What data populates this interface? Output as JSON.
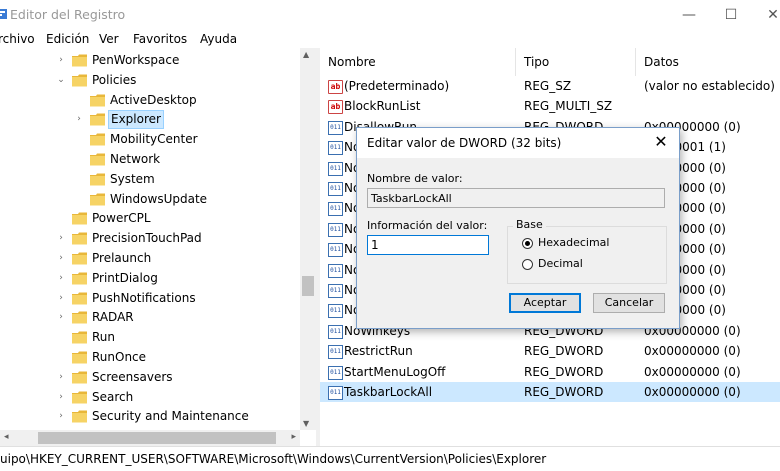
{
  "window": {
    "title": "Editor del Registro",
    "minimize": "—",
    "maximize": "☐",
    "close": "✕"
  },
  "menu": [
    "rchivo",
    "Edición",
    "Ver",
    "Favoritos",
    "Ayuda"
  ],
  "tree": [
    {
      "label": "PenWorkspace",
      "level": 1,
      "arrow": "›"
    },
    {
      "label": "Policies",
      "level": 1,
      "arrow": "⌄"
    },
    {
      "label": "ActiveDesktop",
      "level": 2,
      "arrow": ""
    },
    {
      "label": "Explorer",
      "level": 2,
      "arrow": "›",
      "selected": true
    },
    {
      "label": "MobilityCenter",
      "level": 2,
      "arrow": ""
    },
    {
      "label": "Network",
      "level": 2,
      "arrow": ""
    },
    {
      "label": "System",
      "level": 2,
      "arrow": ""
    },
    {
      "label": "WindowsUpdate",
      "level": 2,
      "arrow": ""
    },
    {
      "label": "PowerCPL",
      "level": 1,
      "arrow": ""
    },
    {
      "label": "PrecisionTouchPad",
      "level": 1,
      "arrow": "›"
    },
    {
      "label": "Prelaunch",
      "level": 1,
      "arrow": "›"
    },
    {
      "label": "PrintDialog",
      "level": 1,
      "arrow": "›"
    },
    {
      "label": "PushNotifications",
      "level": 1,
      "arrow": "›"
    },
    {
      "label": "RADAR",
      "level": 1,
      "arrow": "›"
    },
    {
      "label": "Run",
      "level": 1,
      "arrow": ""
    },
    {
      "label": "RunOnce",
      "level": 1,
      "arrow": ""
    },
    {
      "label": "Screensavers",
      "level": 1,
      "arrow": "›"
    },
    {
      "label": "Search",
      "level": 1,
      "arrow": "›"
    },
    {
      "label": "Security and Maintenance",
      "level": 1,
      "arrow": "›"
    }
  ],
  "list": {
    "columns": [
      "Nombre",
      "Tipo",
      "Datos"
    ],
    "rows": [
      {
        "name": "(Predeterminado)",
        "type": "REG_SZ",
        "data": "(valor no establecido)",
        "icon": "string-value-icon"
      },
      {
        "name": "BlockRunList",
        "type": "REG_MULTI_SZ",
        "data": "",
        "icon": "string-value-icon"
      },
      {
        "name": "DisallowRun",
        "type": "REG_DWORD",
        "data": "0x00000000 (0)",
        "icon": "dword-value-icon"
      },
      {
        "name": "No",
        "type": "",
        "data": "00000001 (1)",
        "icon": "dword-value-icon"
      },
      {
        "name": "No",
        "type": "",
        "data": "00000000 (0)",
        "icon": "dword-value-icon"
      },
      {
        "name": "No",
        "type": "",
        "data": "00000000 (0)",
        "icon": "dword-value-icon"
      },
      {
        "name": "No",
        "type": "",
        "data": "00000000 (0)",
        "icon": "dword-value-icon"
      },
      {
        "name": "No",
        "type": "",
        "data": "00000000 (0)",
        "icon": "dword-value-icon"
      },
      {
        "name": "No",
        "type": "",
        "data": "00000000 (0)",
        "icon": "dword-value-icon"
      },
      {
        "name": "No",
        "type": "",
        "data": "00000000 (0)",
        "icon": "dword-value-icon"
      },
      {
        "name": "No",
        "type": "",
        "data": "00000000 (0)",
        "icon": "dword-value-icon"
      },
      {
        "name": "No",
        "type": "",
        "data": "00000000 (0)",
        "icon": "dword-value-icon"
      },
      {
        "name": "NoWinkeys",
        "type": "REG_DWORD",
        "data": "0x00000000 (0)",
        "icon": "dword-value-icon"
      },
      {
        "name": "RestrictRun",
        "type": "REG_DWORD",
        "data": "0x00000000 (0)",
        "icon": "dword-value-icon"
      },
      {
        "name": "StartMenuLogOff",
        "type": "REG_DWORD",
        "data": "0x00000000 (0)",
        "icon": "dword-value-icon"
      },
      {
        "name": "TaskbarLockAll",
        "type": "REG_DWORD",
        "data": "0x00000000 (0)",
        "icon": "dword-value-icon",
        "selected": true
      }
    ]
  },
  "dialog": {
    "title": "Editar valor de DWORD (32 bits)",
    "close": "✕",
    "name_label": "Nombre de valor:",
    "name_value": "TaskbarLockAll",
    "data_label": "Información del valor:",
    "data_value": "1",
    "base_label": "Base",
    "hex_label": "Hexadecimal",
    "dec_label": "Decimal",
    "base_selected": "Hexadecimal",
    "ok": "Aceptar",
    "cancel": "Cancelar"
  },
  "status": {
    "path": "uipo\\HKEY_CURRENT_USER\\SOFTWARE\\Microsoft\\Windows\\CurrentVersion\\Policies\\Explorer"
  },
  "colors": {
    "folder": "#e8b73a",
    "selection": "#cce8ff",
    "accent": "#0078d7"
  }
}
